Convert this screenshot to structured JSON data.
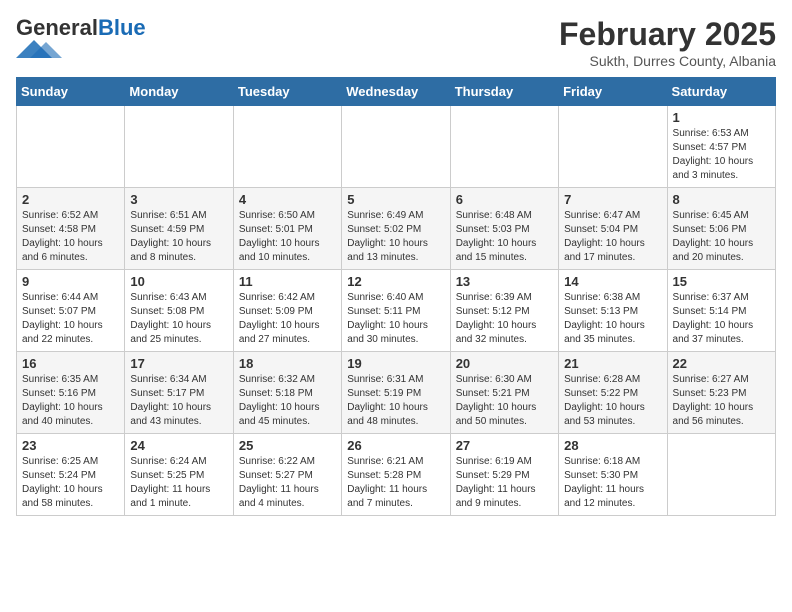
{
  "header": {
    "logo_general": "General",
    "logo_blue": "Blue",
    "title": "February 2025",
    "subtitle": "Sukth, Durres County, Albania"
  },
  "days_of_week": [
    "Sunday",
    "Monday",
    "Tuesday",
    "Wednesday",
    "Thursday",
    "Friday",
    "Saturday"
  ],
  "weeks": [
    [
      {
        "num": "",
        "info": ""
      },
      {
        "num": "",
        "info": ""
      },
      {
        "num": "",
        "info": ""
      },
      {
        "num": "",
        "info": ""
      },
      {
        "num": "",
        "info": ""
      },
      {
        "num": "",
        "info": ""
      },
      {
        "num": "1",
        "info": "Sunrise: 6:53 AM\nSunset: 4:57 PM\nDaylight: 10 hours and 3 minutes."
      }
    ],
    [
      {
        "num": "2",
        "info": "Sunrise: 6:52 AM\nSunset: 4:58 PM\nDaylight: 10 hours and 6 minutes."
      },
      {
        "num": "3",
        "info": "Sunrise: 6:51 AM\nSunset: 4:59 PM\nDaylight: 10 hours and 8 minutes."
      },
      {
        "num": "4",
        "info": "Sunrise: 6:50 AM\nSunset: 5:01 PM\nDaylight: 10 hours and 10 minutes."
      },
      {
        "num": "5",
        "info": "Sunrise: 6:49 AM\nSunset: 5:02 PM\nDaylight: 10 hours and 13 minutes."
      },
      {
        "num": "6",
        "info": "Sunrise: 6:48 AM\nSunset: 5:03 PM\nDaylight: 10 hours and 15 minutes."
      },
      {
        "num": "7",
        "info": "Sunrise: 6:47 AM\nSunset: 5:04 PM\nDaylight: 10 hours and 17 minutes."
      },
      {
        "num": "8",
        "info": "Sunrise: 6:45 AM\nSunset: 5:06 PM\nDaylight: 10 hours and 20 minutes."
      }
    ],
    [
      {
        "num": "9",
        "info": "Sunrise: 6:44 AM\nSunset: 5:07 PM\nDaylight: 10 hours and 22 minutes."
      },
      {
        "num": "10",
        "info": "Sunrise: 6:43 AM\nSunset: 5:08 PM\nDaylight: 10 hours and 25 minutes."
      },
      {
        "num": "11",
        "info": "Sunrise: 6:42 AM\nSunset: 5:09 PM\nDaylight: 10 hours and 27 minutes."
      },
      {
        "num": "12",
        "info": "Sunrise: 6:40 AM\nSunset: 5:11 PM\nDaylight: 10 hours and 30 minutes."
      },
      {
        "num": "13",
        "info": "Sunrise: 6:39 AM\nSunset: 5:12 PM\nDaylight: 10 hours and 32 minutes."
      },
      {
        "num": "14",
        "info": "Sunrise: 6:38 AM\nSunset: 5:13 PM\nDaylight: 10 hours and 35 minutes."
      },
      {
        "num": "15",
        "info": "Sunrise: 6:37 AM\nSunset: 5:14 PM\nDaylight: 10 hours and 37 minutes."
      }
    ],
    [
      {
        "num": "16",
        "info": "Sunrise: 6:35 AM\nSunset: 5:16 PM\nDaylight: 10 hours and 40 minutes."
      },
      {
        "num": "17",
        "info": "Sunrise: 6:34 AM\nSunset: 5:17 PM\nDaylight: 10 hours and 43 minutes."
      },
      {
        "num": "18",
        "info": "Sunrise: 6:32 AM\nSunset: 5:18 PM\nDaylight: 10 hours and 45 minutes."
      },
      {
        "num": "19",
        "info": "Sunrise: 6:31 AM\nSunset: 5:19 PM\nDaylight: 10 hours and 48 minutes."
      },
      {
        "num": "20",
        "info": "Sunrise: 6:30 AM\nSunset: 5:21 PM\nDaylight: 10 hours and 50 minutes."
      },
      {
        "num": "21",
        "info": "Sunrise: 6:28 AM\nSunset: 5:22 PM\nDaylight: 10 hours and 53 minutes."
      },
      {
        "num": "22",
        "info": "Sunrise: 6:27 AM\nSunset: 5:23 PM\nDaylight: 10 hours and 56 minutes."
      }
    ],
    [
      {
        "num": "23",
        "info": "Sunrise: 6:25 AM\nSunset: 5:24 PM\nDaylight: 10 hours and 58 minutes."
      },
      {
        "num": "24",
        "info": "Sunrise: 6:24 AM\nSunset: 5:25 PM\nDaylight: 11 hours and 1 minute."
      },
      {
        "num": "25",
        "info": "Sunrise: 6:22 AM\nSunset: 5:27 PM\nDaylight: 11 hours and 4 minutes."
      },
      {
        "num": "26",
        "info": "Sunrise: 6:21 AM\nSunset: 5:28 PM\nDaylight: 11 hours and 7 minutes."
      },
      {
        "num": "27",
        "info": "Sunrise: 6:19 AM\nSunset: 5:29 PM\nDaylight: 11 hours and 9 minutes."
      },
      {
        "num": "28",
        "info": "Sunrise: 6:18 AM\nSunset: 5:30 PM\nDaylight: 11 hours and 12 minutes."
      },
      {
        "num": "",
        "info": ""
      }
    ]
  ]
}
